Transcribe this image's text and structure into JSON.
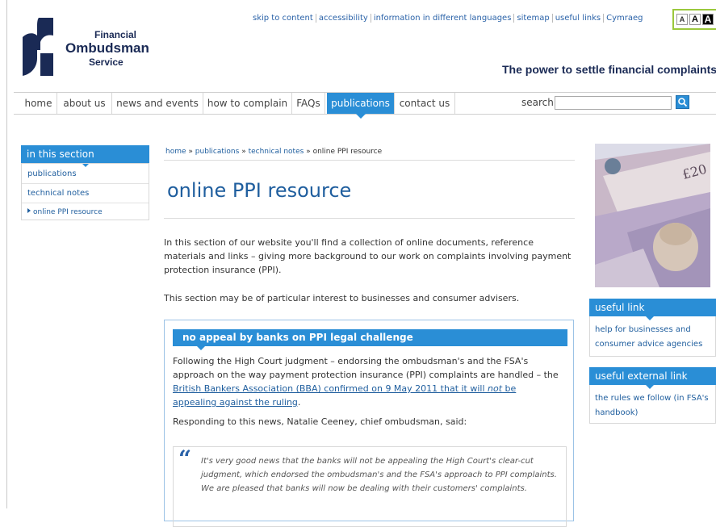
{
  "header": {
    "logo": {
      "line1": "Financial",
      "line2": "Ombudsman",
      "line3": "Service"
    },
    "top_links": [
      "skip to content",
      "accessibility",
      "information in different languages",
      "sitemap",
      "useful links",
      "Cymraeg"
    ],
    "text_size_buttons": [
      "A",
      "A",
      "A"
    ],
    "tagline": "The power to settle financial complaints."
  },
  "nav": {
    "items": [
      "home",
      "about us",
      "news and events",
      "how to complain",
      "FAQs",
      "publications",
      "contact us"
    ],
    "active": "publications",
    "search_label": "search",
    "search_value": ""
  },
  "sidebar": {
    "heading": "in this section",
    "items": [
      "publications",
      "technical notes",
      "online PPI resource"
    ]
  },
  "breadcrumb": {
    "items": [
      "home",
      "publications",
      "technical notes",
      "online PPI resource"
    ],
    "separator": "»"
  },
  "main": {
    "title": "online PPI resource",
    "intro": "In this section of our website you'll find a collection of online documents, reference materials and links – giving more background to our work on complaints involving payment protection insurance (PPI).",
    "intro2": "This section may be of particular interest to businesses and consumer advisers.",
    "news": {
      "heading": "no appeal by banks on PPI legal challenge",
      "p1_before": "Following the High Court judgment – endorsing the ombudsman's and the FSA's approach on the way payment protection insurance (PPI) complaints are handled – the ",
      "p1_link_a": "British Bankers Association (BBA) confirmed on 9 May 2011 that it will ",
      "p1_link_em": "not",
      "p1_link_b": " be appealing against the ruling",
      "p1_after": ".",
      "p2": "Responding to this news, Natalie Ceeney, chief ombudsman, said:",
      "quote_mark": "“",
      "quote": "It's very good news that the banks will not be appealing the High Court's clear-cut judgment, which endorsed the ombudsman's and the FSA's approach to PPI complaints. We are pleased that banks will now be dealing with their customers' complaints."
    }
  },
  "right": {
    "useful_link": {
      "heading": "useful link",
      "link": "help for businesses and consumer advice agencies"
    },
    "useful_external_link": {
      "heading": "useful external link",
      "link": "the rules we follow (in FSA's handbook)"
    }
  },
  "colors": {
    "accent": "#2a8ed6",
    "link": "#1f5e9e",
    "brand_navy": "#1a2a55",
    "highlight": "#9bc83c"
  }
}
